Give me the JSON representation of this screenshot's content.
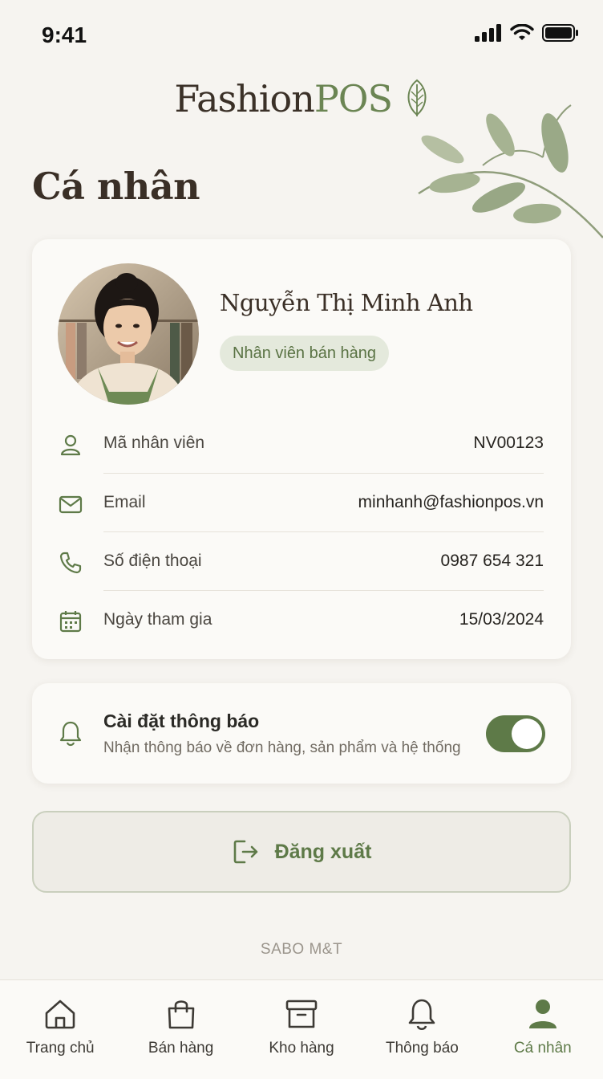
{
  "status_bar": {
    "time": "9:41"
  },
  "brand": {
    "part1": "Fashion",
    "part2": "POS"
  },
  "page_title": "Cá nhân",
  "profile": {
    "name": "Nguyễn Thị Minh Anh",
    "role": "Nhân viên bán hàng",
    "fields": [
      {
        "icon": "user-icon",
        "label": "Mã nhân viên",
        "value": "NV00123"
      },
      {
        "icon": "mail-icon",
        "label": "Email",
        "value": "minhanh@fashionpos.vn"
      },
      {
        "icon": "phone-icon",
        "label": "Số điện thoại",
        "value": "0987 654 321"
      },
      {
        "icon": "calendar-icon",
        "label": "Ngày tham gia",
        "value": "15/03/2024"
      }
    ]
  },
  "notification_settings": {
    "title": "Cài đặt thông báo",
    "subtitle": "Nhận thông báo về đơn hàng, sản phẩm và hệ thống",
    "enabled": true
  },
  "logout": {
    "label": "Đăng xuất"
  },
  "footer": "SABO M&T",
  "tabs": [
    {
      "label": "Trang chủ",
      "icon": "home-icon",
      "active": false
    },
    {
      "label": "Bán hàng",
      "icon": "shopping-bag-icon",
      "active": false
    },
    {
      "label": "Kho hàng",
      "icon": "inventory-box-icon",
      "active": false
    },
    {
      "label": "Thông báo",
      "icon": "bell-icon",
      "active": false
    },
    {
      "label": "Cá nhân",
      "icon": "person-icon",
      "active": true
    }
  ],
  "colors": {
    "accent": "#5e7a48",
    "background": "#f6f4f0",
    "card": "#fbfaf7"
  }
}
